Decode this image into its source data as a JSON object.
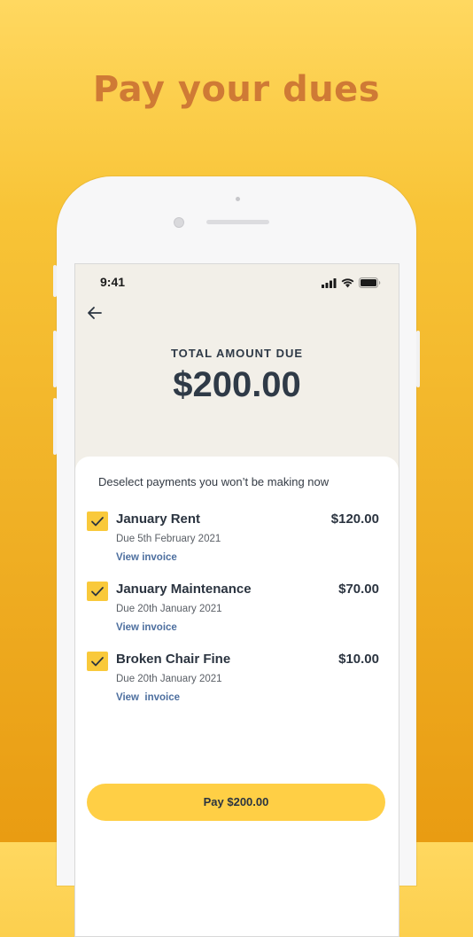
{
  "headline": "Pay your dues",
  "status_bar": {
    "time": "9:41"
  },
  "header": {
    "total_label": "TOTAL AMOUNT DUE",
    "total_amount": "$200.00"
  },
  "instruction": "Deselect payments you won’t be making now",
  "items": [
    {
      "title": "January Rent",
      "amount": "$120.00",
      "due": "Due 5th February 2021",
      "link": "View invoice",
      "checked": true
    },
    {
      "title": "January Maintenance",
      "amount": "$70.00",
      "due": "Due 20th January 2021",
      "link": "View invoice",
      "checked": true
    },
    {
      "title": "Broken Chair Fine",
      "amount": "$10.00",
      "due": "Due 20th January 2021",
      "link": "View  invoice",
      "checked": true
    }
  ],
  "pay_button": {
    "label": "Pay $200.00"
  },
  "colors": {
    "accent": "#f9c93b",
    "link": "#4d6f9f",
    "text": "#2b3440",
    "header_bg": "#f2efe8"
  },
  "icons": [
    "back-arrow-icon",
    "signal-icon",
    "wifi-icon",
    "battery-icon",
    "checkmark-icon"
  ]
}
